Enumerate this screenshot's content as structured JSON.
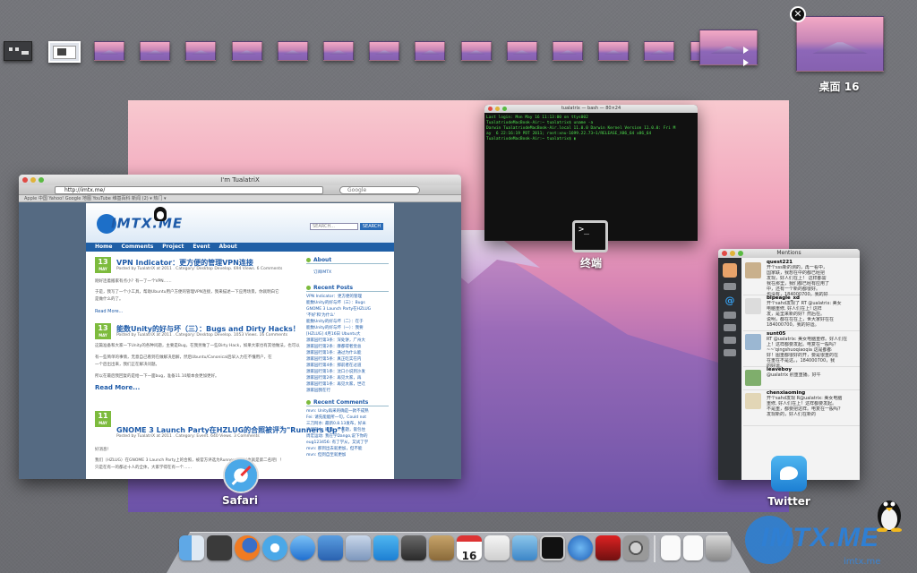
{
  "spaces": {
    "count_small": 14,
    "current_label": "桌面 16",
    "close_glyph": "✕"
  },
  "browser": {
    "window_title": "I'm TualatriX",
    "url": "http://imtx.me/",
    "search_placeholder": "Google",
    "bookmarks": "Apple 中国   Yahoo!   Google 地图   YouTube   维基百科   新闻 (2) ▾   热门 ▾",
    "site": {
      "logo": "IMTX.ME",
      "search_placeholder": "SEARCH...",
      "search_button": "SEARCH",
      "nav": [
        "Home",
        "Comments",
        "Project",
        "Event",
        "About"
      ],
      "posts": [
        {
          "day": "13",
          "month": "MAY",
          "title": "VPN Indicator：更方便的管理VPN连接",
          "meta": "Posted by TualatriX at 2011 . Category: Desktop Develop. 694 Views. 6 Comments",
          "body": [
            "刚好连着搬家有点小？有一了一个VPN……",
            "于是，我写了一个小工具，帮助Ubuntu用户方便的管理VPN连接，我来描述一下应用场景，你就明白它",
            "是做什么的了。"
          ],
          "more": "Read More..."
        },
        {
          "day": "13",
          "month": "MAY",
          "title": "能数Unity的好与坏（三）：Bugs and Dirty Hacks！",
          "meta": "Posted by TualatriX at 2011 . Category: Desktop Develop. 1053 Views. 16 Comments",
          "body": [
            "这篇准备和大家一下Unity的各种问题，主要是Bug，在我另做了一些Dirty Hack，如果大家也有其他做法，也可以",
            "有一些简单的事情，无意自己看到在做解决后解，然后Ubuntu/Canonical后早入力在不懂用户，在",
            "一个后出出来，我们正在解决问题。",
            "所以在最后我回复的是给一下一面bug，准备11.10版本会更加更好。"
          ],
          "more": "Read More..."
        },
        {
          "day": "11",
          "month": "MAY",
          "title": "GNOME 3 Launch Party在HZLUG的合照被评为\"Runners Up\"！",
          "meta": "Posted by TualatriX at 2011 . Category: Event. 640 Views. 3 Comments",
          "body": [
            "好消息！",
            "我们（HZLUG）在GNOME 3 Launch Party上的合照，被官方评选为Runners Up（也就是第二名吧）！",
            "只是在有一的都过十人的全体，大家学得在有一个……"
          ],
          "more": ""
        }
      ],
      "sidebar": {
        "about_title": "About",
        "about_link": "订阅IMTX",
        "recent_posts_title": "Recent Posts",
        "recent_posts": [
          "VPN Indicator：更方便的管理",
          "能数Unity的好与坏（三）：Bugs",
          "GNOME 3 Launch Party在HZLUG",
          "'不好'和'为什么'",
          "能数Unity的好与坏（二）：在于",
          "能数Unity的好与坏（一）：我要",
          "[HZLUG] 4月16日 Ubuntu大",
          "源家园行第3条：深处饼，广州大",
          "源家园行第2条：摩都得者觉总",
          "源家园行第1条：通过为什么能",
          "源家园行第5条：真正吃实在内",
          "源家园行第4条：那前者在过道",
          "源家园行第1条：沈口小说到沙发",
          "源家园行第2条：再见大家，再",
          "源家园行第1条：再见大家，世迁",
          "源家园我在行"
        ],
        "recent_comments_title": "Recent Comments",
        "recent_comments": [
          "mvn: Unity再采的确是一款不成熟",
          "Fei: 请先能能所一句，Could not",
          "三刀阿水: 最新0.8.13发布，好米",
          "清华阿水: 刷着一个问题，嵌包住",
          "周宏运动: 我在学Dango,说下你的",
          "eug123456: 有了学从，又试了学",
          "mvn: 那到出去就更加，但不能",
          "mvn: 但到自至就更加"
        ]
      }
    }
  },
  "terminal": {
    "window_title": "tualatrix — bash — 80×24",
    "lines": [
      "Last login: Mon May 16 11:13:00 on ttys002",
      "TualatrixdeMacBook-Air:~ tualatrix$ uname -a",
      "Darwin TualatrixdeMacBook-Air.local 11.0.0 Darwin Kernel Version 11.0.0: Fri M",
      "ay  6 22:16:19 PDT 2011; root:xnu-1699.22.73~1/RELEASE_X86_64 x86_64",
      "TualatrixdeMacBook-Air:~ tualatrix$ ▮"
    ],
    "label": "终端"
  },
  "twitter": {
    "window_title": "Mentions",
    "tweets": [
      {
        "user": "quest221",
        "lines": [
          "开个sss新的测的，再一看中，",
          "国家联，我想在中的都已经把",
          "发现，好人们在上！ 这样都需",
          "我在那里，我们都已经有应用了",
          "中，还有一个新的都很好。",
          "也没有，184000700，我的好"
        ]
      },
      {
        "user": "bipeagle_xd",
        "lines": [
          "开个sahd发现了 RT @ualatrix: 美女",
          "电脑重修, 好人们在上! 这样",
          "发，是里来新的好？然后在。",
          "说明，都在在在上，世大家好在在",
          "184000700，我的好运。"
        ]
      },
      {
        "user": "sunt05",
        "lines": [
          "RT @ualatrix: 美女电脑重修。好人们在",
          "上！这样都要发起。电复在一般吗？",
          "~~'qingshuoqiaoqia 这是都都",
          "好！图重都很好的开，要是很重的在",
          "在重在不是这。，184000700，我",
          "的好运。"
        ]
      },
      {
        "user": "leaveboy",
        "lines": [
          "@ualatrix 别重重播。好午"
        ]
      },
      {
        "user": "chenxiaoming",
        "lines": [
          "开个sahd发现 R@ualatrix: 美女电脑",
          "重修, 好人们在上！这样都要发起。",
          "不是重，都要把这样。电复在一般吗？",
          "发现新的，好人们在新的"
        ]
      }
    ]
  },
  "labels": {
    "safari": "Safari",
    "twitter": "Twitter"
  },
  "dock": {
    "calendar_day": "16"
  },
  "watermark": {
    "text": "IMTX.ME",
    "sub": "imtx.me"
  }
}
